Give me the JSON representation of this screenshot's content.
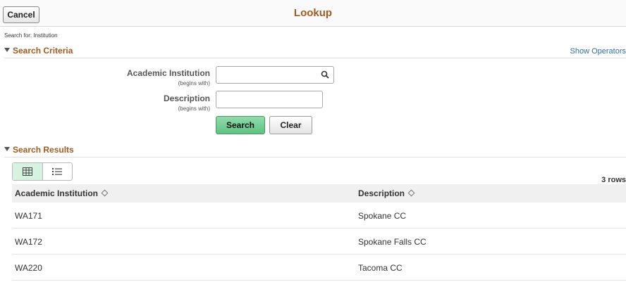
{
  "header": {
    "cancel_label": "Cancel",
    "title": "Lookup"
  },
  "search_for": "Search for:  Institution",
  "criteria": {
    "heading": "Search Criteria",
    "show_operators": "Show Operators",
    "fields": [
      {
        "label": "Academic Institution",
        "qualifier": "(begins with)",
        "value": ""
      },
      {
        "label": "Description",
        "qualifier": "(begins with)",
        "value": ""
      }
    ],
    "search_label": "Search",
    "clear_label": "Clear"
  },
  "results": {
    "heading": "Search Results",
    "row_count": "3 rows",
    "columns": [
      "Academic Institution",
      "Description"
    ],
    "rows": [
      [
        "WA171",
        "Spokane CC"
      ],
      [
        "WA172",
        "Spokane Falls CC"
      ],
      [
        "WA220",
        "Tacoma CC"
      ]
    ]
  },
  "colors": {
    "title": "#a35a1e",
    "link": "#2f6ea8",
    "primary_button": "#5ec383",
    "active_view": "#d6f2e0"
  }
}
